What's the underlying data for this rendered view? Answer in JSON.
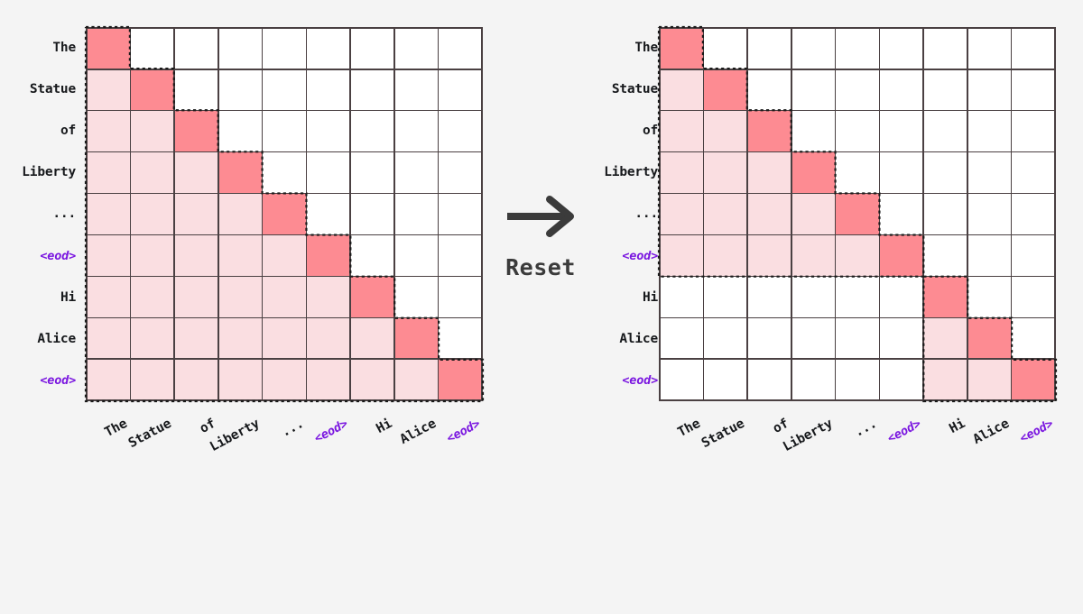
{
  "background_color": "#f4f4f4",
  "colors": {
    "diagonal_cell": "#fd8b92",
    "context_cell": "#fadee1",
    "masked_cell": "#ffffff",
    "grid_line": "#4a4042",
    "boundary_dotted": "#1a1a1a",
    "eod_token": "#7a16e0",
    "label_text": "#17191c",
    "arrow": "#3b3b3b"
  },
  "tokens": [
    "The",
    "Statue",
    "of",
    "Liberty",
    "...",
    "<eod>",
    "Hi",
    "Alice",
    "<eod>"
  ],
  "eod_flags": [
    false,
    false,
    false,
    false,
    false,
    true,
    false,
    false,
    true
  ],
  "transition": {
    "label": "Reset",
    "arrow_icon": "arrow-right-icon"
  },
  "panels": [
    {
      "id": "left",
      "name": "standard-causal-mask",
      "row_labels": [
        "The",
        "Statue",
        "of",
        "Liberty",
        "...",
        "<eod>",
        "Hi",
        "Alice",
        "<eod>"
      ],
      "col_labels": [
        "The",
        "Statue",
        "of",
        "Liberty",
        "...",
        "<eod>",
        "Hi",
        "Alice",
        "<eod>"
      ],
      "blocks": [
        {
          "start": 0,
          "end": 8
        }
      ],
      "mask": [
        [
          1,
          0,
          0,
          0,
          0,
          0,
          0,
          0,
          0
        ],
        [
          1,
          1,
          0,
          0,
          0,
          0,
          0,
          0,
          0
        ],
        [
          1,
          1,
          1,
          0,
          0,
          0,
          0,
          0,
          0
        ],
        [
          1,
          1,
          1,
          1,
          0,
          0,
          0,
          0,
          0
        ],
        [
          1,
          1,
          1,
          1,
          1,
          0,
          0,
          0,
          0
        ],
        [
          1,
          1,
          1,
          1,
          1,
          1,
          0,
          0,
          0
        ],
        [
          1,
          1,
          1,
          1,
          1,
          1,
          1,
          0,
          0
        ],
        [
          1,
          1,
          1,
          1,
          1,
          1,
          1,
          1,
          0
        ],
        [
          1,
          1,
          1,
          1,
          1,
          1,
          1,
          1,
          1
        ]
      ]
    },
    {
      "id": "right",
      "name": "document-reset-block-mask",
      "row_labels": [
        "The",
        "Statue",
        "of",
        "Liberty",
        "...",
        "<eod>",
        "Hi",
        "Alice",
        "<eod>"
      ],
      "col_labels": [
        "The",
        "Statue",
        "of",
        "Liberty",
        "...",
        "<eod>",
        "Hi",
        "Alice",
        "<eod>"
      ],
      "blocks": [
        {
          "start": 0,
          "end": 5
        },
        {
          "start": 6,
          "end": 8
        }
      ],
      "mask": [
        [
          1,
          0,
          0,
          0,
          0,
          0,
          0,
          0,
          0
        ],
        [
          1,
          1,
          0,
          0,
          0,
          0,
          0,
          0,
          0
        ],
        [
          1,
          1,
          1,
          0,
          0,
          0,
          0,
          0,
          0
        ],
        [
          1,
          1,
          1,
          1,
          0,
          0,
          0,
          0,
          0
        ],
        [
          1,
          1,
          1,
          1,
          1,
          0,
          0,
          0,
          0
        ],
        [
          1,
          1,
          1,
          1,
          1,
          1,
          0,
          0,
          0
        ],
        [
          0,
          0,
          0,
          0,
          0,
          0,
          1,
          0,
          0
        ],
        [
          0,
          0,
          0,
          0,
          0,
          0,
          1,
          1,
          0
        ],
        [
          0,
          0,
          0,
          0,
          0,
          0,
          1,
          1,
          1
        ]
      ]
    }
  ]
}
